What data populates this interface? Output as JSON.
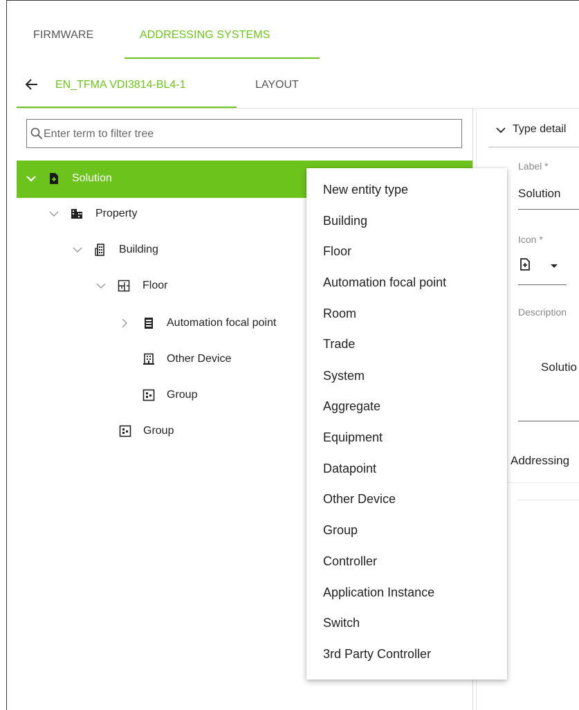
{
  "colors": {
    "accent": "#6cc31c",
    "text": "#222222"
  },
  "top_tabs": [
    {
      "label": "FIRMWARE",
      "active": false
    },
    {
      "label": "ADDRESSING SYSTEMS",
      "active": true
    }
  ],
  "sub_tabs": {
    "name": "EN_TFMA VDI3814-BL4-1",
    "layout": "LAYOUT",
    "back_icon": "arrow-left-icon"
  },
  "search": {
    "placeholder": "Enter term to filter tree",
    "value": ""
  },
  "tree": {
    "root": {
      "label": "Solution",
      "icon": "file-plus-icon",
      "selected": true
    },
    "nodes": [
      {
        "label": "Property",
        "icon": "property-icon"
      },
      {
        "label": "Building",
        "icon": "building-icon"
      },
      {
        "label": "Floor",
        "icon": "floor-icon"
      },
      {
        "label": "Automation focal point",
        "icon": "server-icon"
      },
      {
        "label": "Other Device",
        "icon": "device-icon"
      },
      {
        "label": "Group",
        "icon": "group-icon"
      },
      {
        "label": "Group",
        "icon": "group-icon"
      }
    ]
  },
  "details": {
    "header": "Type detail",
    "label_field": {
      "label": "Label *",
      "value": "Solution"
    },
    "icon_field": {
      "label": "Icon *",
      "icon": "file-plus-icon"
    },
    "description": {
      "label": "Description",
      "value": "Solutio"
    },
    "addressing": "Addressing"
  },
  "menu": {
    "items": [
      "New entity type",
      "Building",
      "Floor",
      "Automation focal point",
      "Room",
      "Trade",
      "System",
      "Aggregate",
      "Equipment",
      "Datapoint",
      "Other Device",
      "Group",
      "Controller",
      "Application Instance",
      "Switch",
      "3rd Party Controller"
    ]
  }
}
